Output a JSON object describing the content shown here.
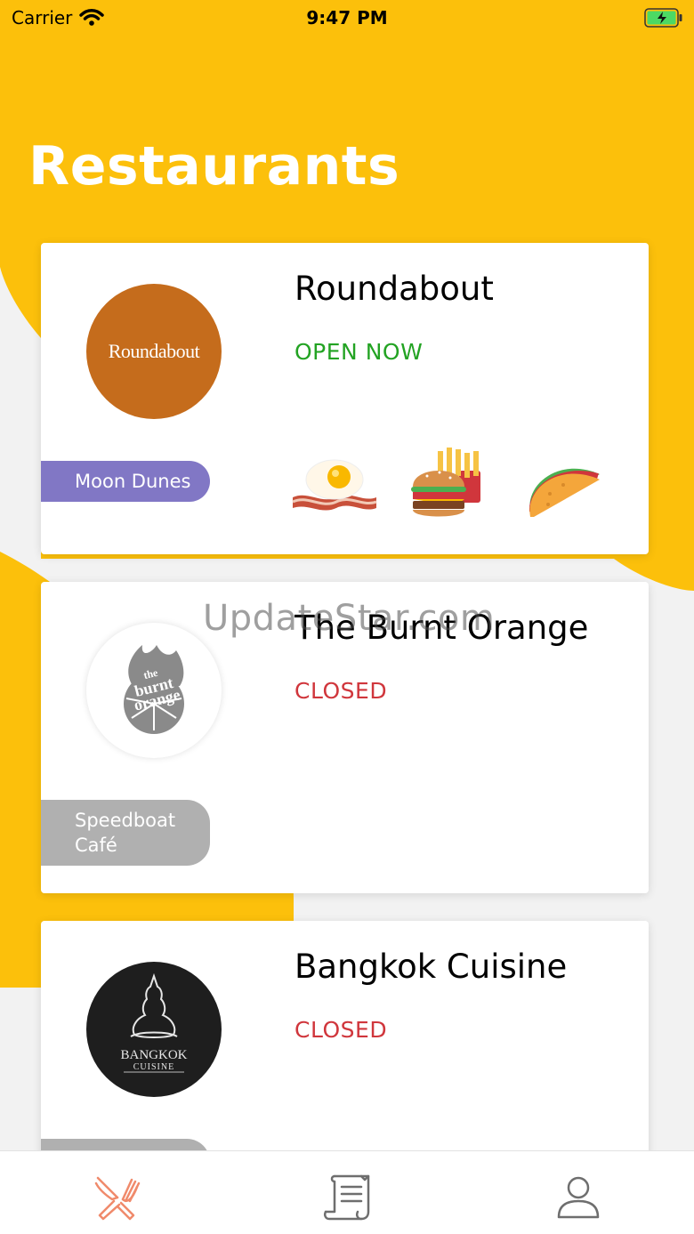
{
  "status_bar": {
    "carrier": "Carrier",
    "time": "9:47 PM"
  },
  "page": {
    "title": "Restaurants"
  },
  "colors": {
    "background_yellow": "#FCC00B",
    "open": "#23A323",
    "closed": "#D0363C",
    "location_active": "#8177C5",
    "location_inactive": "#B0B0B0",
    "tab_active": "#F08A6B",
    "tab_inactive": "#6E6E6E"
  },
  "restaurants": [
    {
      "name": "Roundabout",
      "status": "OPEN NOW",
      "location": "Moon Dunes",
      "logo_text": "Roundabout",
      "food_icons": [
        "bacon-and-egg-icon",
        "burger-and-fries-icon",
        "taco-icon"
      ]
    },
    {
      "name": "The Burnt Orange",
      "status": "CLOSED",
      "location": "Speedboat Café",
      "logo_text": [
        "the",
        "burnt",
        "orange"
      ]
    },
    {
      "name": "Bangkok Cuisine",
      "status": "CLOSED",
      "location": "",
      "logo_text": [
        "BANGKOK",
        "CUISINE"
      ]
    }
  ],
  "watermark": "UpdateStar.com",
  "tabs": [
    {
      "icon": "fork-knife-icon",
      "active": true
    },
    {
      "icon": "receipt-icon",
      "active": false
    },
    {
      "icon": "profile-icon",
      "active": false
    }
  ]
}
